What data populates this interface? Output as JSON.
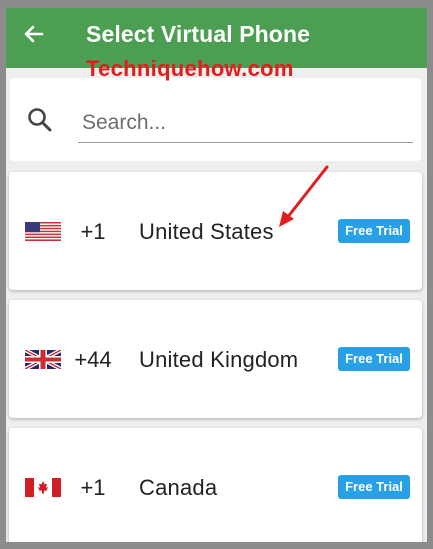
{
  "header": {
    "title": "Select Virtual Phone",
    "back_icon": "arrow-left-icon",
    "background": "#4c9e52"
  },
  "watermark": "Techniquehow.com",
  "search": {
    "placeholder": "Search...",
    "value": "",
    "icon": "search-icon"
  },
  "countries": [
    {
      "code": "+1",
      "name": "United States",
      "flag": "us-flag-icon",
      "badge": "Free Trial"
    },
    {
      "code": "+44",
      "name": "United Kingdom",
      "flag": "uk-flag-icon",
      "badge": "Free Trial"
    },
    {
      "code": "+1",
      "name": "Canada",
      "flag": "canada-flag-icon",
      "badge": "Free Trial"
    }
  ],
  "colors": {
    "badge": "#28a0e6",
    "watermark": "#e11d1d",
    "annotation_arrow": "#e11d1d"
  }
}
